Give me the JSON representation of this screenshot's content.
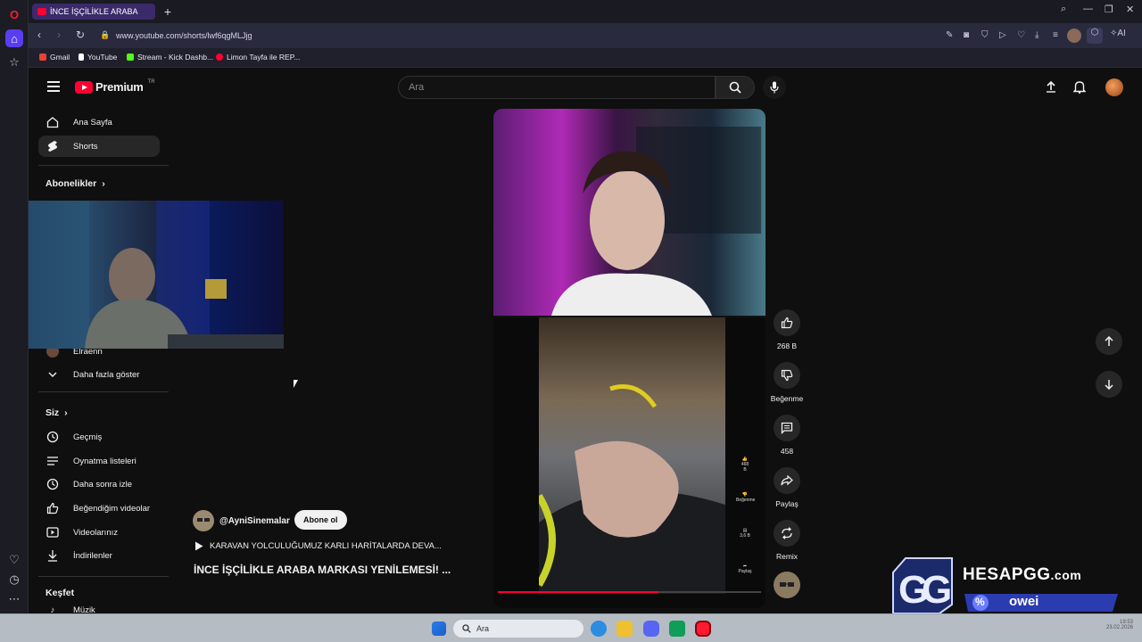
{
  "browser": {
    "tab_title": "İNCE İŞÇİLİKLE ARABA",
    "url": "www.youtube.com/shorts/lwf6qgMLJjg",
    "ai_label": "AI",
    "bookmarks": [
      {
        "label": "Gmail",
        "color": "#ea4335"
      },
      {
        "label": "YouTube",
        "color": "#ffffff"
      },
      {
        "label": "Stream - Kick Dashb...",
        "color": "#53fc18"
      },
      {
        "label": "Limon Tayfa ile REP...",
        "color": "#ff0033"
      }
    ]
  },
  "youtube": {
    "logo_text": "Premium",
    "logo_badge": "TR",
    "search_placeholder": "Ara",
    "sidebar": {
      "home": "Ana Sayfa",
      "shorts": "Shorts",
      "subs_heading": "Abonelikler",
      "sub_channel": "Elraenn",
      "show_more": "Daha fazla göster",
      "you_heading": "Siz",
      "you_items": [
        "Geçmiş",
        "Oynatma listeleri",
        "Daha sonra izle",
        "Beğendiğim videolar",
        "Videolarınız",
        "İndirilenler"
      ],
      "explore_heading": "Keşfet",
      "explore_partial": "Müzik"
    },
    "short": {
      "channel": "@AyniSinemalar",
      "subscribe": "Abone ol",
      "playlist_line": "KARAVAN YOLCULUĞUMUZ KARLI HARİTALARDA DEVA...",
      "title": "İNCE İŞÇİLİKLE ARABA MARKASI YENİLEMESİ! ...",
      "progress": 0.61,
      "inner_labels": [
        "468 B",
        "Beğenme",
        "3,6 B",
        "Paylaş"
      ]
    },
    "actions": {
      "likes": "268 B",
      "dislike": "Beğenme",
      "comments": "458",
      "share": "Paylaş",
      "remix": "Remix"
    }
  },
  "overlay": {
    "brand": "HESAPGG",
    "domain_suffix": ".com",
    "percent": "%",
    "code": "owei"
  },
  "taskbar": {
    "search_text": "Ara",
    "clock": "19:53",
    "date": "23.02.2026"
  }
}
